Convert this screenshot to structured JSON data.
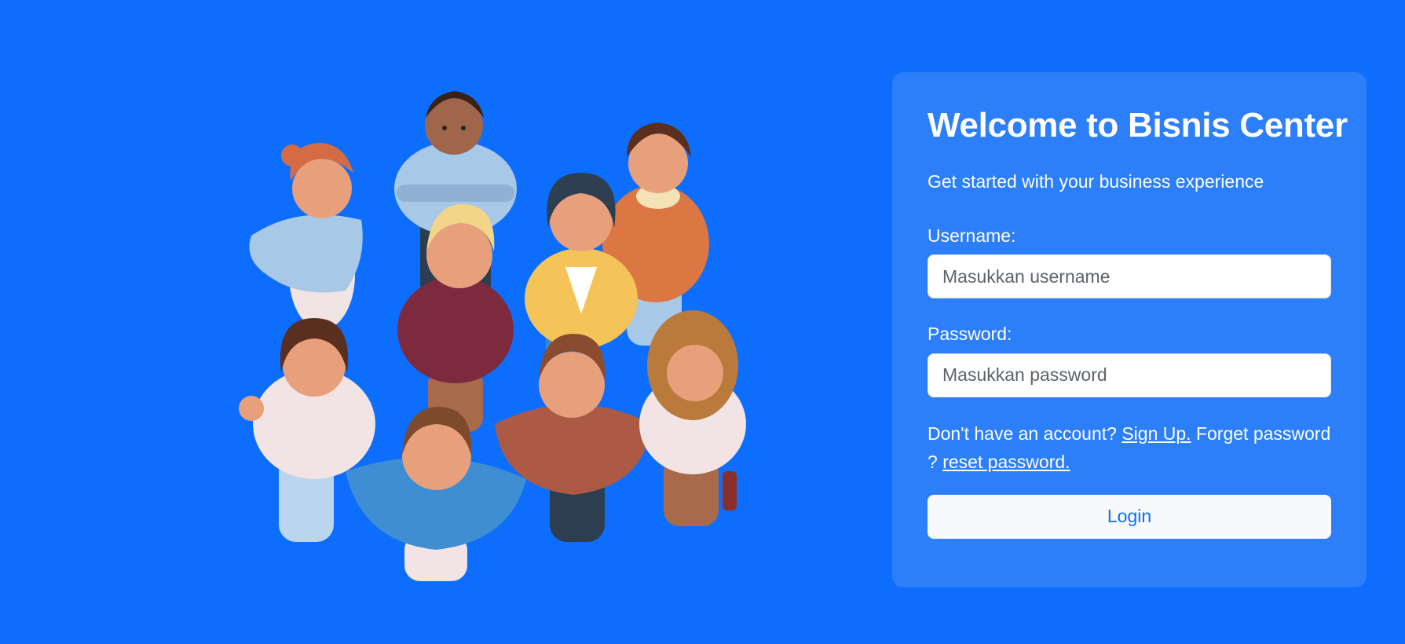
{
  "card": {
    "title": "Welcome to Bisnis Center",
    "subtitle": "Get started with your business experience"
  },
  "form": {
    "username_label": "Username:",
    "username_placeholder": "Masukkan username",
    "password_label": "Password:",
    "password_placeholder": "Masukkan password",
    "no_account_text": "Don't have an account?",
    "signup_link": "Sign Up.",
    "forget_text": "Forget password ?",
    "reset_link": "reset password.",
    "login_button": "Login"
  },
  "colors": {
    "background": "#0d6efd",
    "card": "#2c7ef9",
    "button_bg": "#f8f9fa",
    "button_text": "#0d6efd"
  },
  "icons": {
    "hero": "group-of-people-illustration"
  }
}
